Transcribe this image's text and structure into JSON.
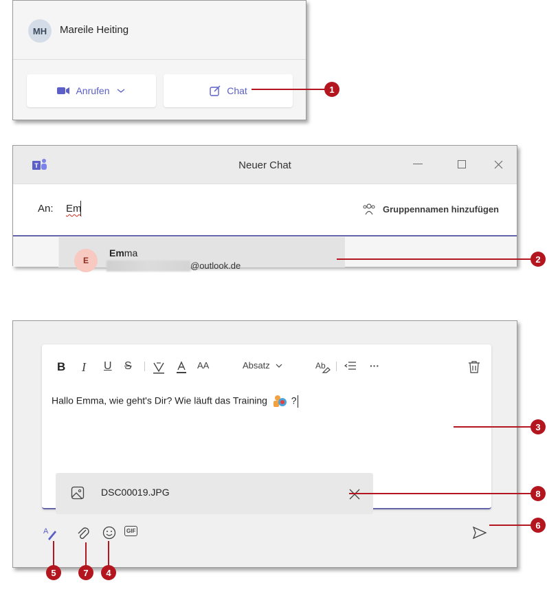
{
  "contact_card": {
    "avatar_initials": "MH",
    "name": "Mareile Heiting",
    "call_label": "Anrufen",
    "chat_label": "Chat"
  },
  "new_chat": {
    "window_title": "Neuer Chat",
    "to_label": "An:",
    "to_value": "Em",
    "group_name_label": "Gruppennamen hinzufügen",
    "suggestion": {
      "avatar_initial": "E",
      "name_match": "Em",
      "name_rest": "ma",
      "email_domain": "@outlook.de"
    }
  },
  "compose": {
    "toolbar": {
      "bold": "B",
      "italic": "I",
      "underline": "U",
      "strike": "S",
      "paragraph": "Absatz",
      "more": "···",
      "font_size": "AA"
    },
    "message": "Hallo Emma, wie geht's Dir? Wie läuft das Training",
    "message_end": "?",
    "attachment_name": "DSC00019.JPG",
    "gif_label": "GIF"
  },
  "callouts": [
    "1",
    "2",
    "3",
    "8",
    "6",
    "5",
    "7",
    "4"
  ],
  "colors": {
    "accent": "#5b5fc7",
    "callout": "#b3161e"
  }
}
